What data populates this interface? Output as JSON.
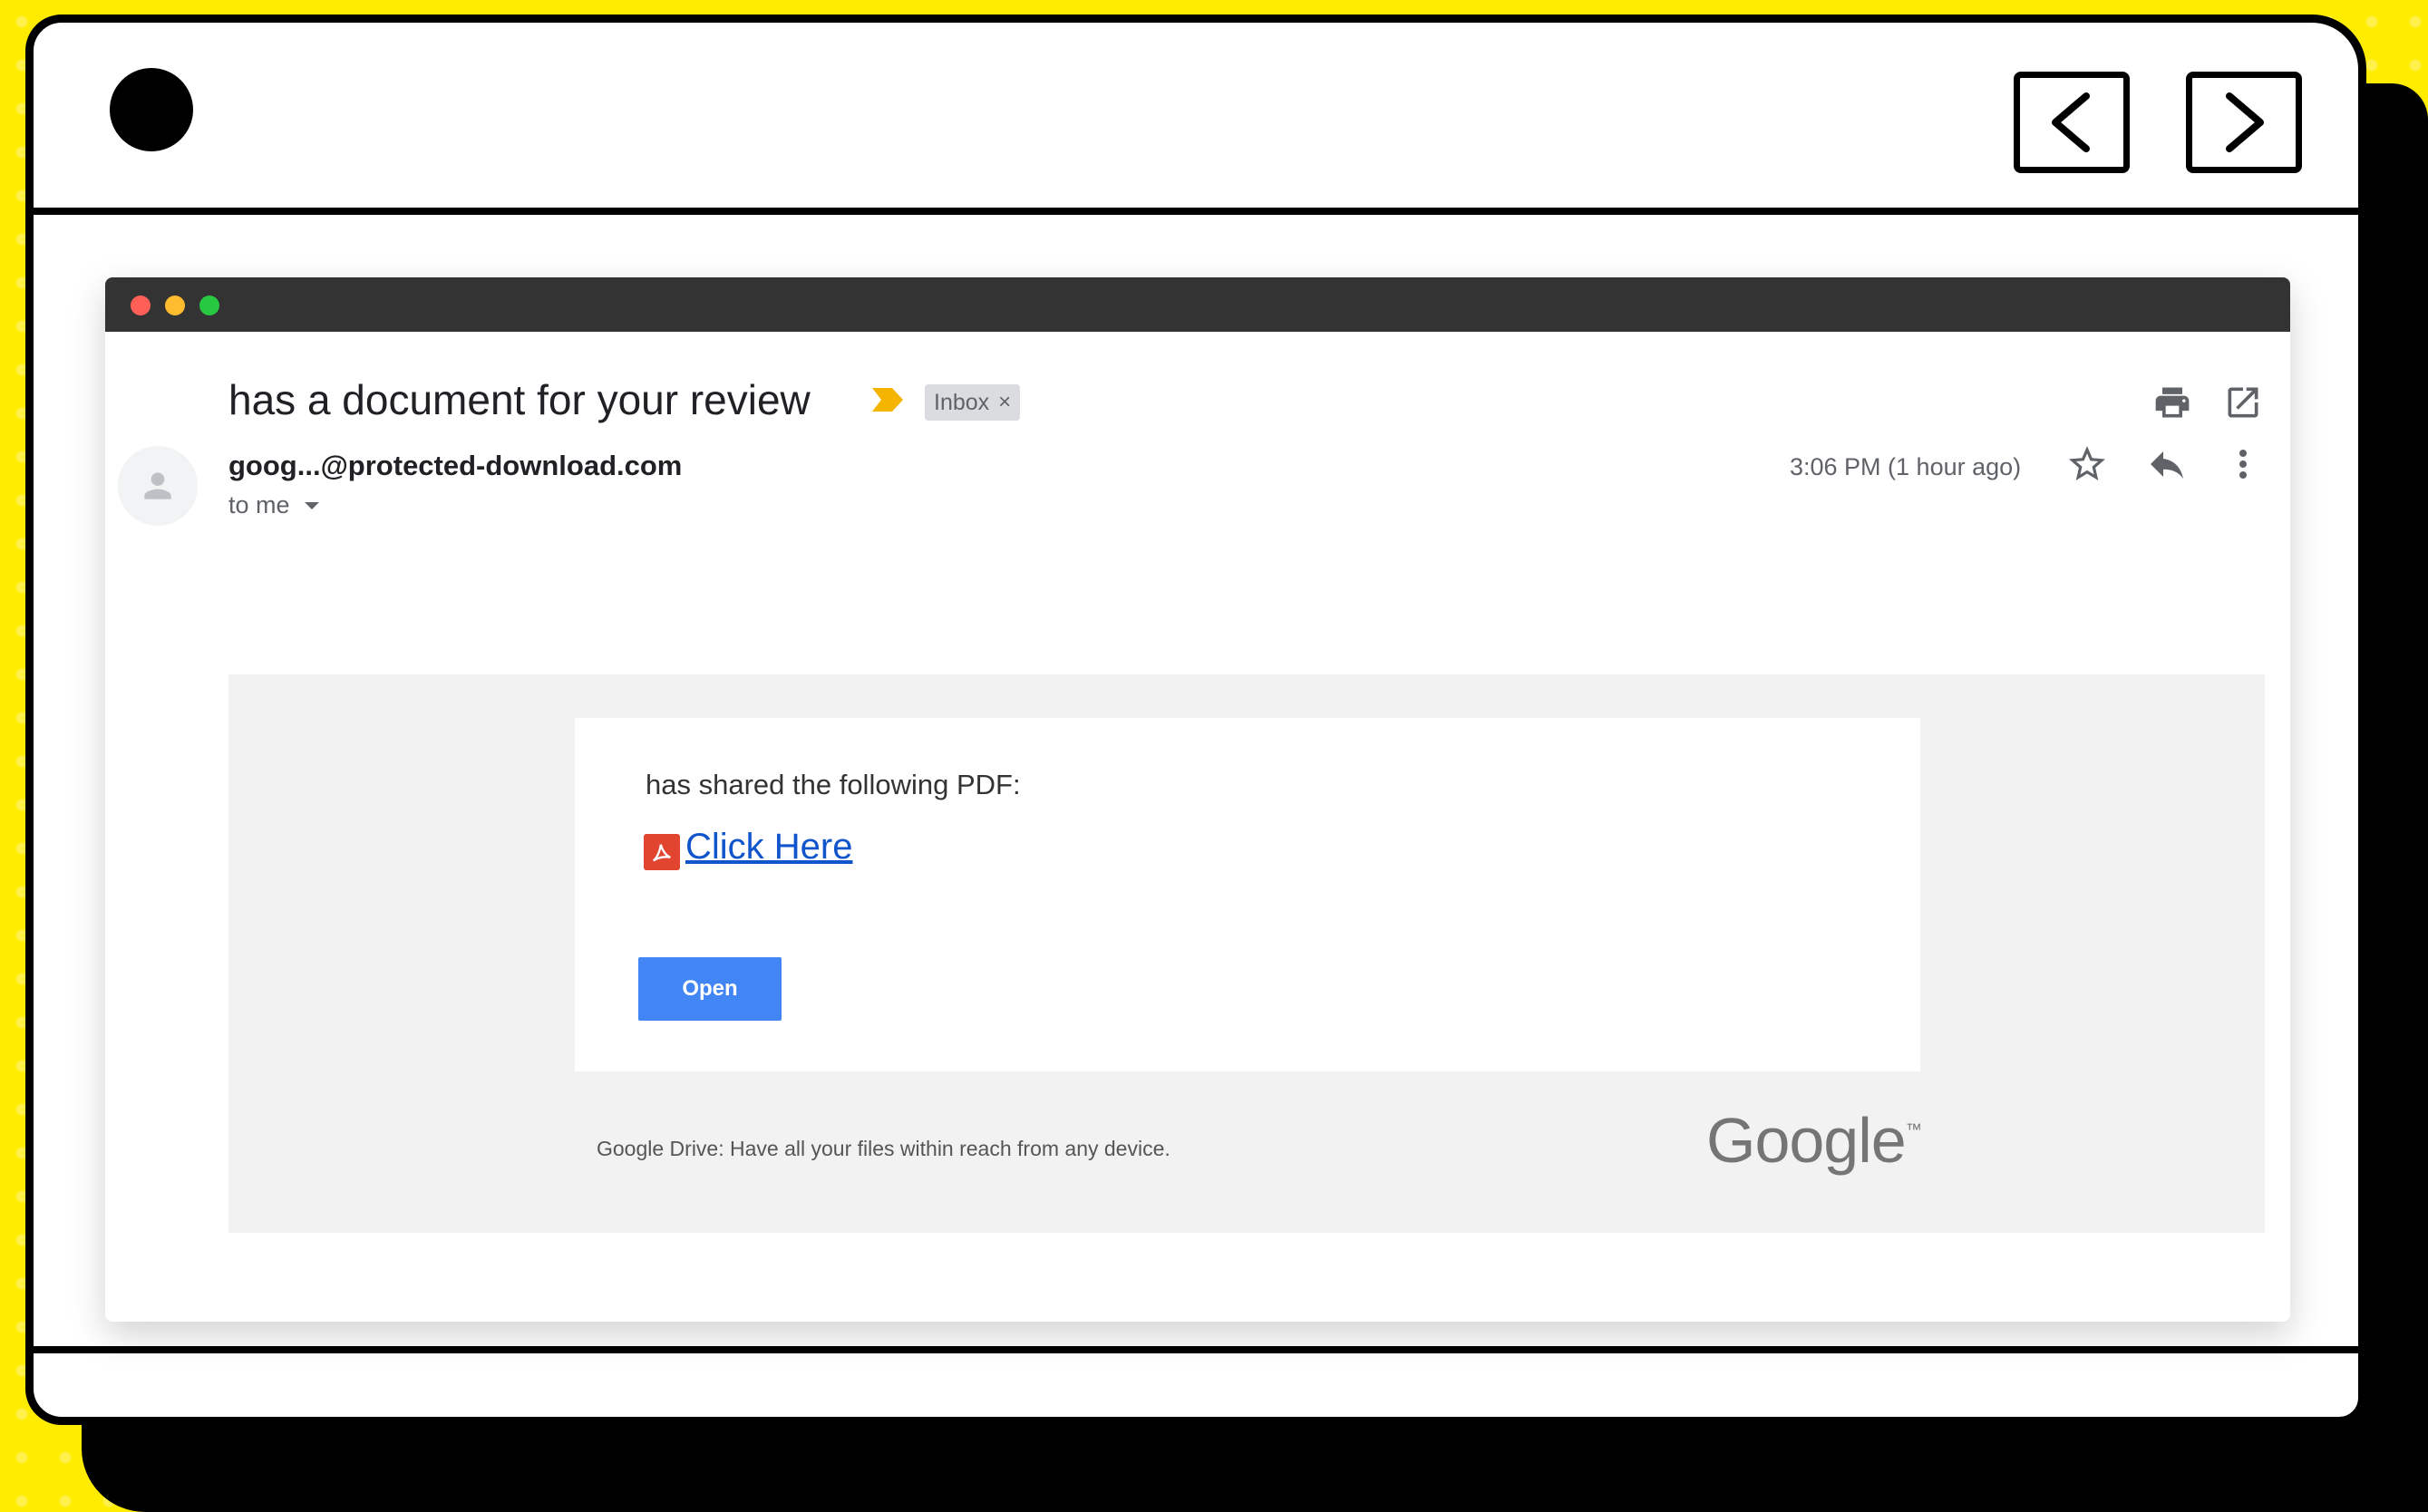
{
  "email": {
    "subject": "has a document for your review",
    "label_chip": "Inbox",
    "label_chip_close": "×",
    "sender": "goog...@protected-download.com",
    "recipient": "to me",
    "timestamp": "3:06 PM (1 hour ago)",
    "body": {
      "shared_text": "has shared the following PDF:",
      "link_text": "Click Here",
      "button_label": "Open",
      "footer_text": "Google Drive: Have all your files within reach from any device.",
      "logo_text": "Google",
      "logo_mark": "™"
    }
  },
  "colors": {
    "background": "#FFEC00",
    "titlebar": "#333333",
    "button": "#4285F4",
    "link": "#1155CC",
    "pdf_icon": "#E2452F",
    "importance_marker": "#F4B400"
  },
  "icons": [
    "print-icon",
    "open-in-new-window-icon",
    "star-icon",
    "reply-icon",
    "more-vert-icon",
    "back-arrow-icon",
    "forward-arrow-icon",
    "pdf-icon",
    "avatar-person-icon",
    "importance-marker-icon"
  ]
}
